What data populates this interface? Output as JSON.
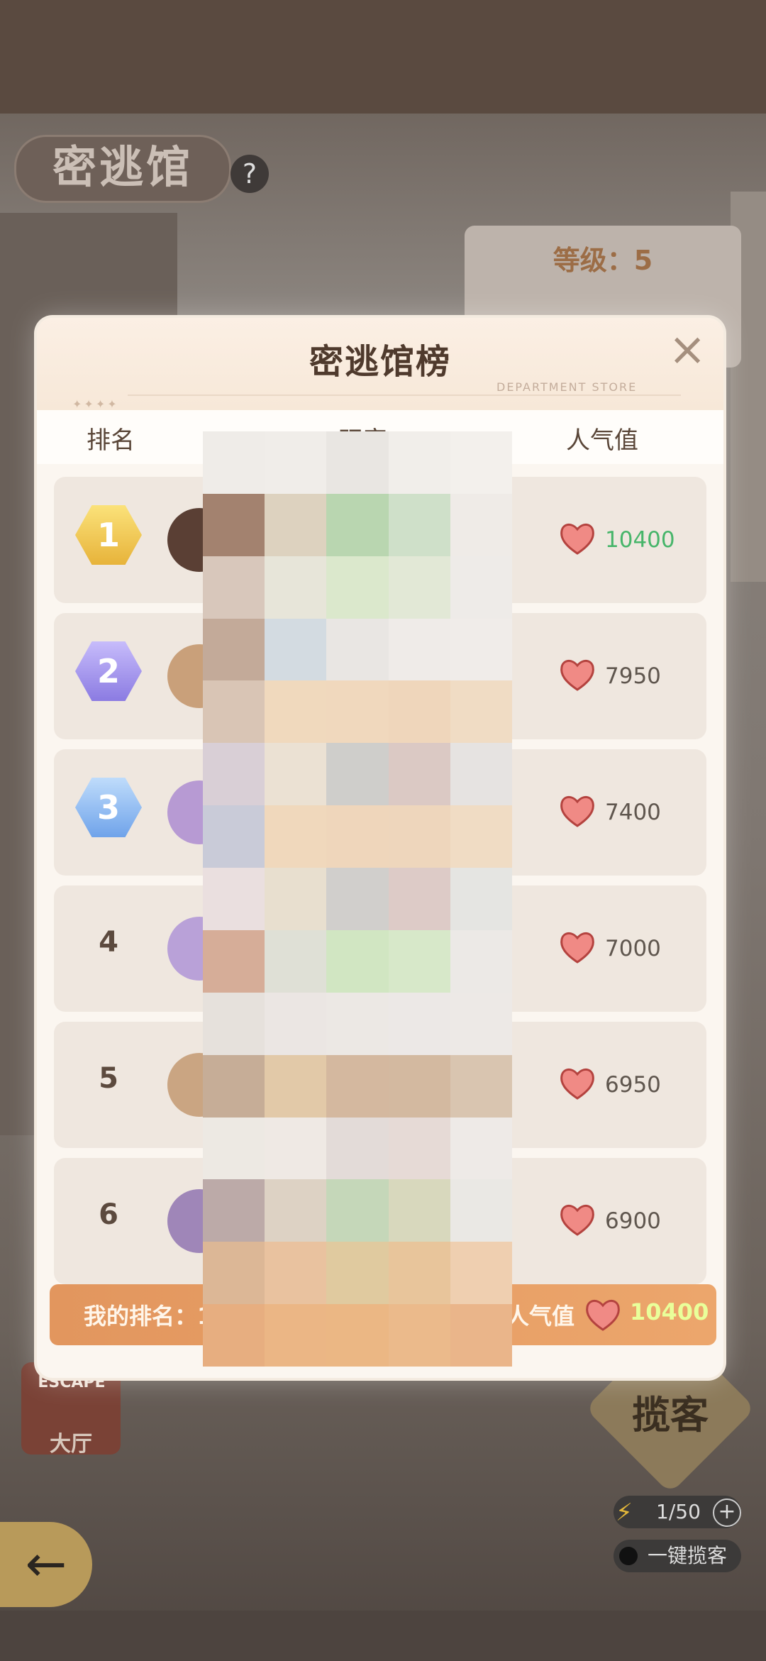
{
  "background": {
    "scene_title": "密逃馆",
    "help_label": "?",
    "level_label": "等级：5",
    "lobby_label": "大厅",
    "lobby_sign": "ESCAPE",
    "invite_label": "揽客",
    "energy": "1/50",
    "one_click_invite": "一键揽客"
  },
  "modal": {
    "title": "密逃馆榜",
    "subtitle": "DEPARTMENT STORE",
    "columns": {
      "rank": "排名",
      "player": "玩家",
      "popularity": "人气值"
    },
    "rows": [
      {
        "rank": "1",
        "score": "10400",
        "highlight": true
      },
      {
        "rank": "2",
        "score": "7950",
        "highlight": false
      },
      {
        "rank": "3",
        "score": "7400",
        "highlight": false
      },
      {
        "rank": "4",
        "score": "7000",
        "highlight": false
      },
      {
        "rank": "5",
        "score": "6950",
        "highlight": false
      },
      {
        "rank": "6",
        "score": "6900",
        "highlight": false
      }
    ],
    "my_rank": {
      "label": "我的排名：1",
      "popularity_label": "人气值",
      "score": "10400"
    }
  },
  "colors": {
    "gold": "#f1c54a",
    "purple": "#9f8ff0",
    "blue": "#8ab9f2",
    "heart": "#f08a85",
    "green_score": "#47b56a"
  }
}
